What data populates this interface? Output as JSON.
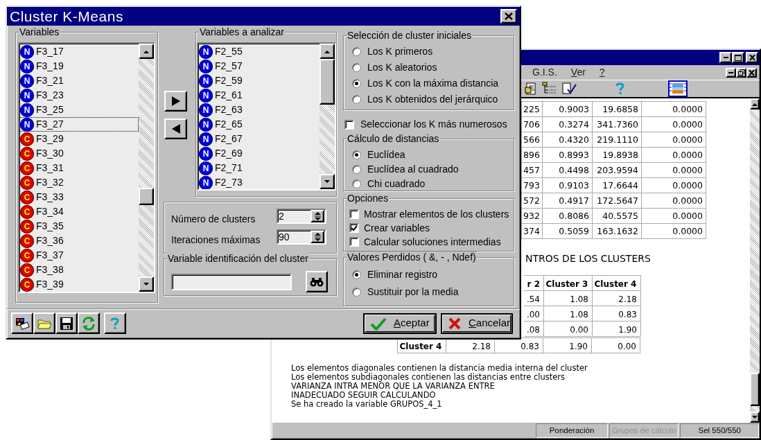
{
  "report_window": {
    "menu": [
      {
        "label": "G.I.S.",
        "underline_first": false
      },
      {
        "label": "Ver",
        "underline_first": true
      },
      {
        "label": "?",
        "underline_first": true
      }
    ],
    "top_table": {
      "rows": [
        [
          "225",
          "0.9003",
          "19.6858",
          "0.0000"
        ],
        [
          "706",
          "0.3274",
          "341.7360",
          "0.0000"
        ],
        [
          "566",
          "0.4320",
          "219.1110",
          "0.0000"
        ],
        [
          "896",
          "0.8993",
          "19.8938",
          "0.0000"
        ],
        [
          "457",
          "0.4498",
          "203.9594",
          "0.0000"
        ],
        [
          "793",
          "0.9103",
          "17.6644",
          "0.0000"
        ],
        [
          "572",
          "0.4917",
          "172.5647",
          "0.0000"
        ],
        [
          "932",
          "0.8086",
          "40.5575",
          "0.0000"
        ],
        [
          "374",
          "0.5059",
          "163.1632",
          "0.0000"
        ]
      ]
    },
    "heading": "NTROS DE LOS CLUSTERS",
    "cluster_table": {
      "header": [
        "r 2",
        "Cluster 3",
        "Cluster 4"
      ],
      "rows": [
        [
          ".54",
          "1.08",
          "2.18"
        ],
        [
          ".00",
          "1.08",
          "0.83"
        ],
        [
          ".08",
          "0.00",
          "1.90"
        ]
      ],
      "last_row": [
        "Cluster 4",
        "2.18",
        "0.83",
        "1.90",
        "0.00"
      ]
    },
    "messages": [
      "Los elementos diagonales contienen la distancia media interna del cluster",
      "Los elementos subdiagonales contienen las distancias entre clusters",
      "VARIANZA INTRA MENOR QUE LA VARIANZA ENTRE",
      "INADECUADO SEGUIR CALCULANDO",
      "Se ha creado la variable GRUPOS_4_1"
    ],
    "status": [
      {
        "text": "Ponderación",
        "disabled": false
      },
      {
        "text": "Grupos de cálculo",
        "disabled": true
      },
      {
        "text": "Sel 550/550",
        "disabled": false
      }
    ]
  },
  "dialog": {
    "title": "Cluster K-Means",
    "variables": {
      "label": "Variables",
      "items": [
        {
          "name": "F3_17",
          "type": "N",
          "focused": false
        },
        {
          "name": "F3_19",
          "type": "N",
          "focused": false
        },
        {
          "name": "F3_21",
          "type": "N",
          "focused": false
        },
        {
          "name": "F3_23",
          "type": "N",
          "focused": false
        },
        {
          "name": "F3_25",
          "type": "N",
          "focused": false
        },
        {
          "name": "F3_27",
          "type": "N",
          "focused": true
        },
        {
          "name": "F3_29",
          "type": "C",
          "focused": false
        },
        {
          "name": "F3_30",
          "type": "C",
          "focused": false
        },
        {
          "name": "F3_31",
          "type": "C",
          "focused": false
        },
        {
          "name": "F3_32",
          "type": "C",
          "focused": false
        },
        {
          "name": "F3_33",
          "type": "C",
          "focused": false
        },
        {
          "name": "F3_34",
          "type": "C",
          "focused": false
        },
        {
          "name": "F3_35",
          "type": "C",
          "focused": false
        },
        {
          "name": "F3_36",
          "type": "C",
          "focused": false
        },
        {
          "name": "F3_37",
          "type": "C",
          "focused": false
        },
        {
          "name": "F3_38",
          "type": "C",
          "focused": false
        },
        {
          "name": "F3_39",
          "type": "C",
          "focused": false
        }
      ]
    },
    "analyze": {
      "label": "Variables a analizar",
      "items": [
        {
          "name": "F2_55",
          "type": "N"
        },
        {
          "name": "F2_57",
          "type": "N"
        },
        {
          "name": "F2_59",
          "type": "N"
        },
        {
          "name": "F2_61",
          "type": "N"
        },
        {
          "name": "F2_63",
          "type": "N"
        },
        {
          "name": "F2_65",
          "type": "N"
        },
        {
          "name": "F2_67",
          "type": "N"
        },
        {
          "name": "F2_69",
          "type": "N"
        },
        {
          "name": "F2_71",
          "type": "N"
        },
        {
          "name": "F2_73",
          "type": "N"
        }
      ]
    },
    "params": [
      {
        "label": "Número de clusters",
        "value": "2"
      },
      {
        "label": "Iteraciones máximas",
        "value": "90"
      }
    ],
    "id_variable": {
      "label": "Variable identificación del cluster"
    },
    "initial_selection": {
      "label": "Selección de cluster iniciales",
      "options": [
        {
          "label": "Los K primeros",
          "selected": false
        },
        {
          "label": "Los K aleatorios",
          "selected": false
        },
        {
          "label": "Los K con la máxima distancia",
          "selected": true
        },
        {
          "label": "Los K obtenidos del jerárquico",
          "selected": false
        }
      ]
    },
    "largest": {
      "label": "Seleccionar los K más numerosos",
      "checked": false
    },
    "distance": {
      "label": "Cálculo de distancias",
      "options": [
        {
          "label": "Euclídea",
          "selected": true
        },
        {
          "label": "Euclídea al cuadrado",
          "selected": false
        },
        {
          "label": "Chi cuadrado",
          "selected": false
        }
      ]
    },
    "options": {
      "label": "Opciones",
      "items": [
        {
          "label": "Mostrar elementos de los clusters",
          "checked": false
        },
        {
          "label": "Crear variables",
          "checked": true
        },
        {
          "label": "Calcular soluciones intermedias",
          "checked": false
        }
      ]
    },
    "missing": {
      "label": "Valores Perdidos ( &, - , Ndef)",
      "options": [
        {
          "label": "Eliminar registro",
          "selected": true
        },
        {
          "label": "Sustituir por la media",
          "selected": false
        }
      ]
    },
    "buttons": [
      {
        "label": "Aceptar",
        "kind": "ok",
        "underline_first": true
      },
      {
        "label": "Cancelar",
        "kind": "cancel",
        "underline_first": true
      }
    ]
  }
}
